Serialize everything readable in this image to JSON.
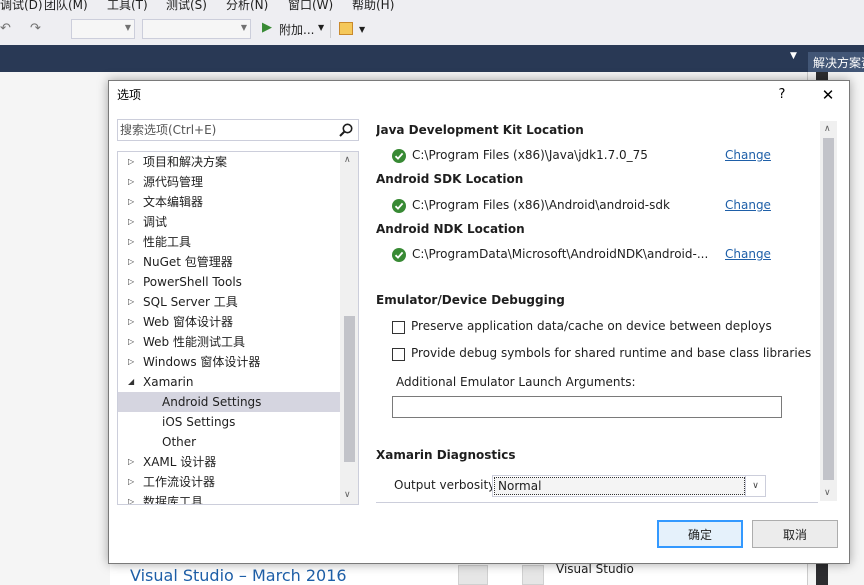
{
  "ide": {
    "menu": [
      "调试(D)",
      "团队(M)",
      "工具(T)",
      "测试(S)",
      "分析(N)",
      "窗口(W)",
      "帮助(H)"
    ],
    "toolbar": {
      "attach_label": "附加..."
    },
    "solution_explorer_title": "解决方案资源管理器",
    "start_page_title": "Visual Studio – March 2016",
    "start_page_caption": "Visual Studio"
  },
  "dialog": {
    "title": "选项",
    "help_glyph": "?",
    "close_glyph": "✕",
    "search": {
      "placeholder": "搜索选项(Ctrl+E)",
      "value": ""
    },
    "tree": [
      {
        "label": "项目和解决方案",
        "level": 0,
        "expanded": false,
        "selected": false
      },
      {
        "label": "源代码管理",
        "level": 0,
        "expanded": false,
        "selected": false
      },
      {
        "label": "文本编辑器",
        "level": 0,
        "expanded": false,
        "selected": false
      },
      {
        "label": "调试",
        "level": 0,
        "expanded": false,
        "selected": false
      },
      {
        "label": "性能工具",
        "level": 0,
        "expanded": false,
        "selected": false
      },
      {
        "label": "NuGet 包管理器",
        "level": 0,
        "expanded": false,
        "selected": false
      },
      {
        "label": "PowerShell Tools",
        "level": 0,
        "expanded": false,
        "selected": false
      },
      {
        "label": "SQL Server 工具",
        "level": 0,
        "expanded": false,
        "selected": false
      },
      {
        "label": "Web 窗体设计器",
        "level": 0,
        "expanded": false,
        "selected": false
      },
      {
        "label": "Web 性能测试工具",
        "level": 0,
        "expanded": false,
        "selected": false
      },
      {
        "label": "Windows 窗体设计器",
        "level": 0,
        "expanded": false,
        "selected": false
      },
      {
        "label": "Xamarin",
        "level": 0,
        "expanded": true,
        "selected": false
      },
      {
        "label": "Android Settings",
        "level": 1,
        "expanded": null,
        "selected": true
      },
      {
        "label": "iOS Settings",
        "level": 1,
        "expanded": null,
        "selected": false
      },
      {
        "label": "Other",
        "level": 1,
        "expanded": null,
        "selected": false
      },
      {
        "label": "XAML 设计器",
        "level": 0,
        "expanded": false,
        "selected": false
      },
      {
        "label": "工作流设计器",
        "level": 0,
        "expanded": false,
        "selected": false
      },
      {
        "label": "数据库工具",
        "level": 0,
        "expanded": false,
        "selected": false
      }
    ],
    "content": {
      "jdk": {
        "title": "Java Development Kit Location",
        "path": "C:\\Program Files (x86)\\Java\\jdk1.7.0_75",
        "change": "Change"
      },
      "sdk": {
        "title": "Android SDK Location",
        "path": "C:\\Program Files (x86)\\Android\\android-sdk",
        "change": "Change"
      },
      "ndk": {
        "title": "Android NDK Location",
        "path": "C:\\ProgramData\\Microsoft\\AndroidNDK\\android-...",
        "change": "Change"
      },
      "emulator": {
        "title": "Emulator/Device Debugging",
        "preserve_label": "Preserve application data/cache on device between deploys",
        "preserve_checked": false,
        "debug_symbols_label": "Provide debug symbols for shared runtime and base class libraries",
        "debug_symbols_checked": false,
        "args_label": "Additional Emulator Launch Arguments:",
        "args_value": ""
      },
      "diagnostics": {
        "title": "Xamarin Diagnostics",
        "verbosity_label": "Output verbosity:",
        "verbosity_value": "Normal"
      }
    },
    "buttons": {
      "ok": "确定",
      "cancel": "取消"
    }
  },
  "colors": {
    "accent": "#3399ff",
    "link": "#1e5fa8",
    "check_green": "#388a34",
    "selection": "#d5d5e0",
    "ide_dark": "#293955"
  },
  "icons": [
    "undo-icon",
    "redo-icon",
    "start-icon",
    "toolbar-extra-icon",
    "search-icon",
    "check-icon",
    "expand-arrow-icon",
    "collapse-arrow-icon"
  ]
}
